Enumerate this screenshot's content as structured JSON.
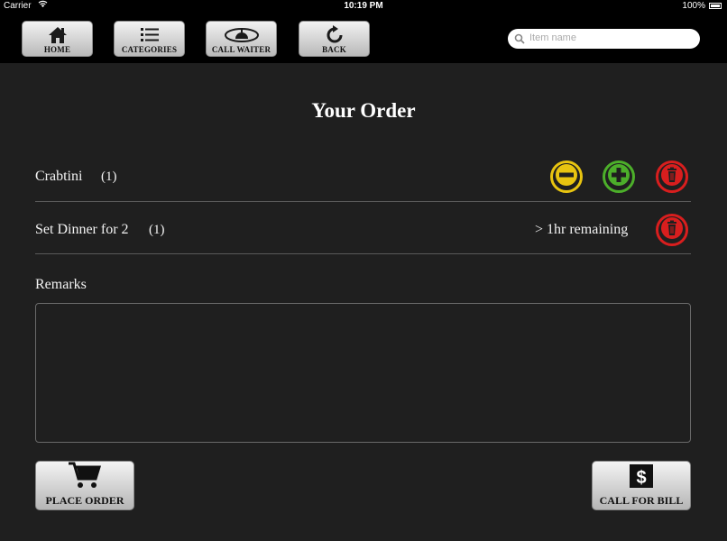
{
  "status_bar": {
    "carrier": "Carrier",
    "time": "10:19 PM",
    "battery": "100%"
  },
  "toolbar": {
    "buttons": [
      {
        "label": "HOME",
        "icon": "home-icon"
      },
      {
        "label": "CATEGORIES",
        "icon": "list-icon"
      },
      {
        "label": "CALL WAITER",
        "icon": "waiter-icon"
      },
      {
        "label": "BACK",
        "icon": "refresh-back-icon"
      }
    ],
    "search": {
      "placeholder": "Item name",
      "value": ""
    }
  },
  "page_title": "Your Order",
  "order_items": [
    {
      "name": "Crabtini",
      "quantity": "(1)",
      "actions": [
        "decrease",
        "increase",
        "delete"
      ]
    },
    {
      "name": "Set Dinner for 2",
      "quantity": "(1)",
      "remaining": "> 1hr  remaining",
      "actions": [
        "delete"
      ]
    }
  ],
  "remarks": {
    "label": "Remarks",
    "value": ""
  },
  "actions": {
    "place_order": "PLACE ORDER",
    "call_for_bill": "CALL FOR BILL"
  },
  "colors": {
    "background": "#1f1f1f",
    "toolbar": "#000000",
    "minus": "#e8c410",
    "plus": "#4caf2a",
    "delete": "#d81e1e"
  }
}
